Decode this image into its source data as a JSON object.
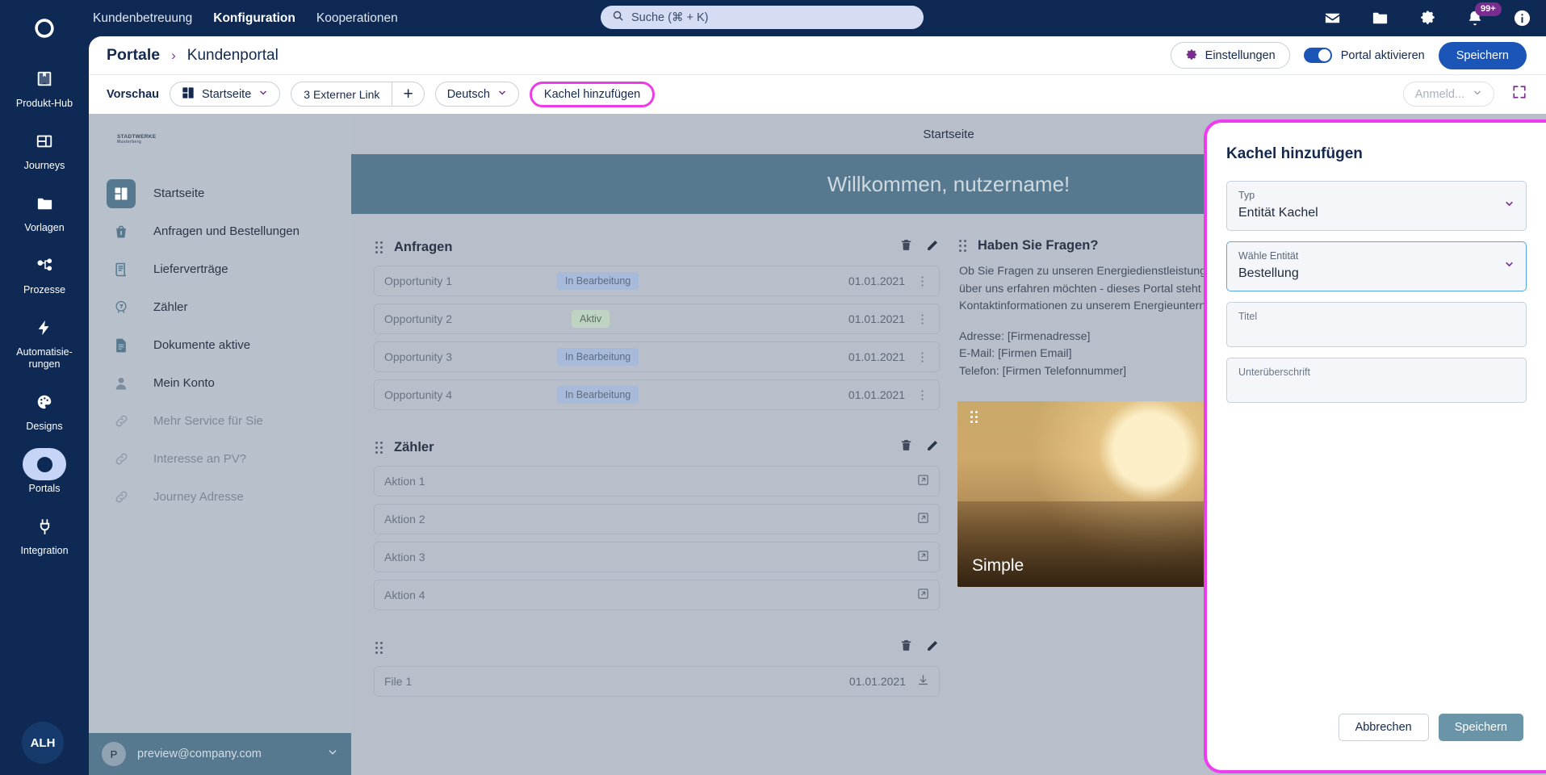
{
  "rail": {
    "logo_icon": "brand-swirl-icon",
    "items": [
      {
        "label": "Produkt-Hub",
        "icon": "book-icon",
        "active": false
      },
      {
        "label": "Journeys",
        "icon": "layout-icon",
        "active": false
      },
      {
        "label": "Vorlagen",
        "icon": "folder-icon",
        "active": false
      },
      {
        "label": "Prozesse",
        "icon": "flow-icon",
        "active": false
      },
      {
        "label": "Automatisie-\nrungen",
        "icon": "bolt-icon",
        "active": false
      },
      {
        "label": "Designs",
        "icon": "palette-icon",
        "active": false
      },
      {
        "label": "Portals",
        "icon": "globe-icon",
        "active": true
      },
      {
        "label": "Integration",
        "icon": "plug-icon",
        "active": false
      }
    ],
    "avatar_initials": "ALH"
  },
  "topbar": {
    "nav": [
      {
        "label": "Kundenbetreuung",
        "active": false
      },
      {
        "label": "Konfiguration",
        "active": true
      },
      {
        "label": "Kooperationen",
        "active": false
      }
    ],
    "search_placeholder": "Suche (⌘ + K)",
    "icons": [
      {
        "name": "mail-icon"
      },
      {
        "name": "folder-icon"
      },
      {
        "name": "gear-icon"
      },
      {
        "name": "bell-icon",
        "badge": "99+"
      },
      {
        "name": "info-icon"
      }
    ]
  },
  "header": {
    "breadcrumb_root": "Portale",
    "breadcrumb_sep": "›",
    "breadcrumb_leaf": "Kundenportal",
    "settings_label": "Einstellungen",
    "toggle_label": "Portal aktivieren",
    "toggle_on": true,
    "save_label": "Speichern"
  },
  "toolbar": {
    "preview_label": "Vorschau",
    "page_select": "Startseite",
    "external_link": "3 Externer Link",
    "add_symbol": "+",
    "language": "Deutsch",
    "add_tile": "Kachel hinzufügen",
    "login_select": "Anmeld...",
    "fullscreen_icon": "expand-icon"
  },
  "preview": {
    "brand_name": "STADTWERKE",
    "brand_sub": "Musterberg",
    "menu": [
      {
        "label": "Startseite",
        "icon": "dashboard-icon",
        "active": true,
        "muted": false
      },
      {
        "label": "Anfragen und Bestellungen",
        "icon": "basket-icon",
        "active": false,
        "muted": false
      },
      {
        "label": "Lieferverträge",
        "icon": "contract-icon",
        "active": false,
        "muted": false
      },
      {
        "label": "Zähler",
        "icon": "meter-icon",
        "active": false,
        "muted": false
      },
      {
        "label": "Dokumente aktive",
        "icon": "document-icon",
        "active": false,
        "muted": false
      },
      {
        "label": "Mein Konto",
        "icon": "person-icon",
        "active": false,
        "muted": false
      },
      {
        "label": "Mehr Service für Sie",
        "icon": "link-icon",
        "active": false,
        "muted": true
      },
      {
        "label": "Interesse an PV?",
        "icon": "link-icon",
        "active": false,
        "muted": true
      },
      {
        "label": "Journey Adresse",
        "icon": "link-icon",
        "active": false,
        "muted": true
      }
    ],
    "footer_email": "preview@company.com",
    "footer_avatar": "P",
    "top_strip": "Startseite",
    "banner": "Willkommen, nutzername!",
    "cards": {
      "anfragen": {
        "title": "Anfragen",
        "rows": [
          {
            "name": "Opportunity 1",
            "status": "In Bearbeitung",
            "status_kind": "prog",
            "date": "01.01.2021"
          },
          {
            "name": "Opportunity 2",
            "status": "Aktiv",
            "status_kind": "act",
            "date": "01.01.2021"
          },
          {
            "name": "Opportunity 3",
            "status": "In Bearbeitung",
            "status_kind": "prog",
            "date": "01.01.2021"
          },
          {
            "name": "Opportunity 4",
            "status": "In Bearbeitung",
            "status_kind": "prog",
            "date": "01.01.2021"
          }
        ]
      },
      "zaehler": {
        "title": "Zähler",
        "rows": [
          {
            "name": "Aktion 1"
          },
          {
            "name": "Aktion 2"
          },
          {
            "name": "Aktion 3"
          },
          {
            "name": "Aktion 4"
          }
        ]
      },
      "files": {
        "title": "",
        "rows": [
          {
            "name": "File 1",
            "date": "01.01.2021"
          }
        ]
      },
      "faq": {
        "title": "Haben Sie Fragen?",
        "paragraph": "Ob Sie Fragen zu unseren Energiedienstleistungen haben, ein Anliegen klären möchten oder einfach mehr über uns erfahren möchten - dieses Portal steht Ihnen zur Verfügung. Hier finden Sie wichtige Kontaktinformationen zu unserem Energieunternehmen:",
        "address": "Adresse: [Firmenadresse]",
        "email": "E-Mail: [Firmen Email]",
        "phone": "Telefon: [Firmen Telefonnummer]"
      },
      "photo": {
        "caption": "Simple"
      }
    }
  },
  "panel": {
    "title": "Kachel hinzufügen",
    "fields": [
      {
        "label": "Typ",
        "value": "Entität Kachel",
        "kind": "select",
        "focused": false
      },
      {
        "label": "Wähle Entität",
        "value": "Bestellung",
        "kind": "select",
        "focused": true
      },
      {
        "label": "Titel",
        "value": "",
        "kind": "text",
        "focused": false
      },
      {
        "label": "Unterüberschrift",
        "value": "",
        "kind": "text",
        "focused": false
      }
    ],
    "cancel_label": "Abbrechen",
    "save_label": "Speichern"
  },
  "colors": {
    "navy": "#0e2a54",
    "accent_blue": "#1b55b8",
    "highlight_pink": "#ee3cef",
    "purple": "#7a2d8f",
    "preview_accent": "#56798f"
  }
}
